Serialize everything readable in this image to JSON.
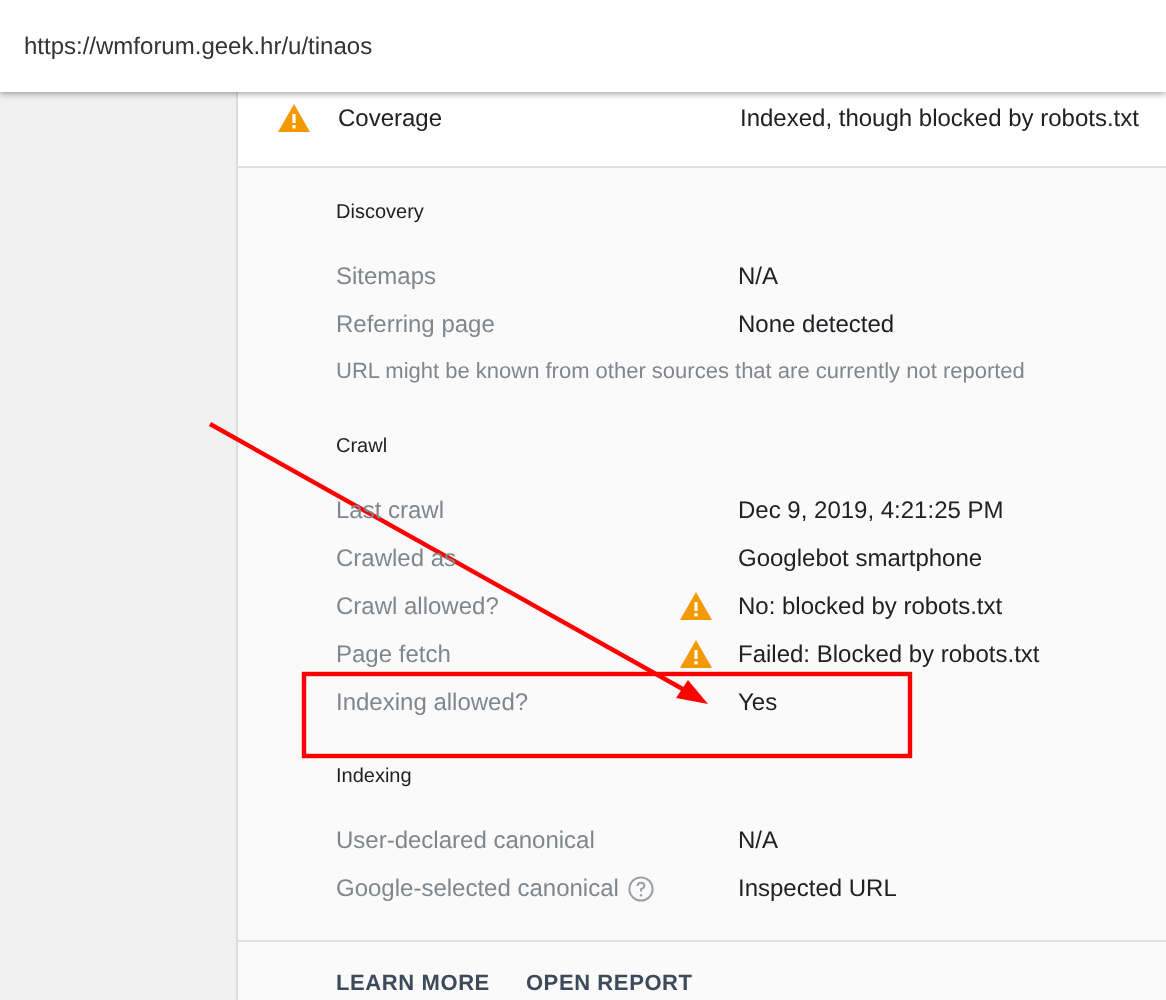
{
  "address_bar": {
    "url": "https://wmforum.geek.hr/u/tinaos"
  },
  "coverage": {
    "label": "Coverage",
    "value": "Indexed, though blocked by robots.txt",
    "warning": true
  },
  "sections": [
    {
      "title": "Discovery",
      "rows": [
        {
          "kind": "pair",
          "label": "Sitemaps",
          "value": "N/A",
          "warning": false,
          "help": false
        },
        {
          "kind": "pair",
          "label": "Referring page",
          "value": "None detected",
          "warning": false,
          "help": false
        },
        {
          "kind": "note",
          "label": "URL might be known from other sources that are currently not reported"
        }
      ]
    },
    {
      "title": "Crawl",
      "rows": [
        {
          "kind": "pair",
          "label": "Last crawl",
          "value": "Dec 9, 2019, 4:21:25 PM",
          "warning": false,
          "help": false
        },
        {
          "kind": "pair",
          "label": "Crawled as",
          "value": "Googlebot smartphone",
          "warning": false,
          "help": false
        },
        {
          "kind": "pair",
          "label": "Crawl allowed?",
          "value": "No: blocked by robots.txt",
          "warning": true,
          "help": false
        },
        {
          "kind": "pair",
          "label": "Page fetch",
          "value": "Failed: Blocked by robots.txt",
          "warning": true,
          "help": false
        },
        {
          "kind": "pair",
          "label": "Indexing allowed?",
          "value": "Yes",
          "warning": false,
          "help": false
        }
      ]
    },
    {
      "title": "Indexing",
      "rows": [
        {
          "kind": "pair",
          "label": "User-declared canonical",
          "value": "N/A",
          "warning": false,
          "help": false
        },
        {
          "kind": "pair",
          "label": "Google-selected canonical",
          "value": "Inspected URL",
          "warning": false,
          "help": true
        }
      ]
    }
  ],
  "footer_buttons": [
    "LEARN MORE",
    "OPEN REPORT"
  ]
}
